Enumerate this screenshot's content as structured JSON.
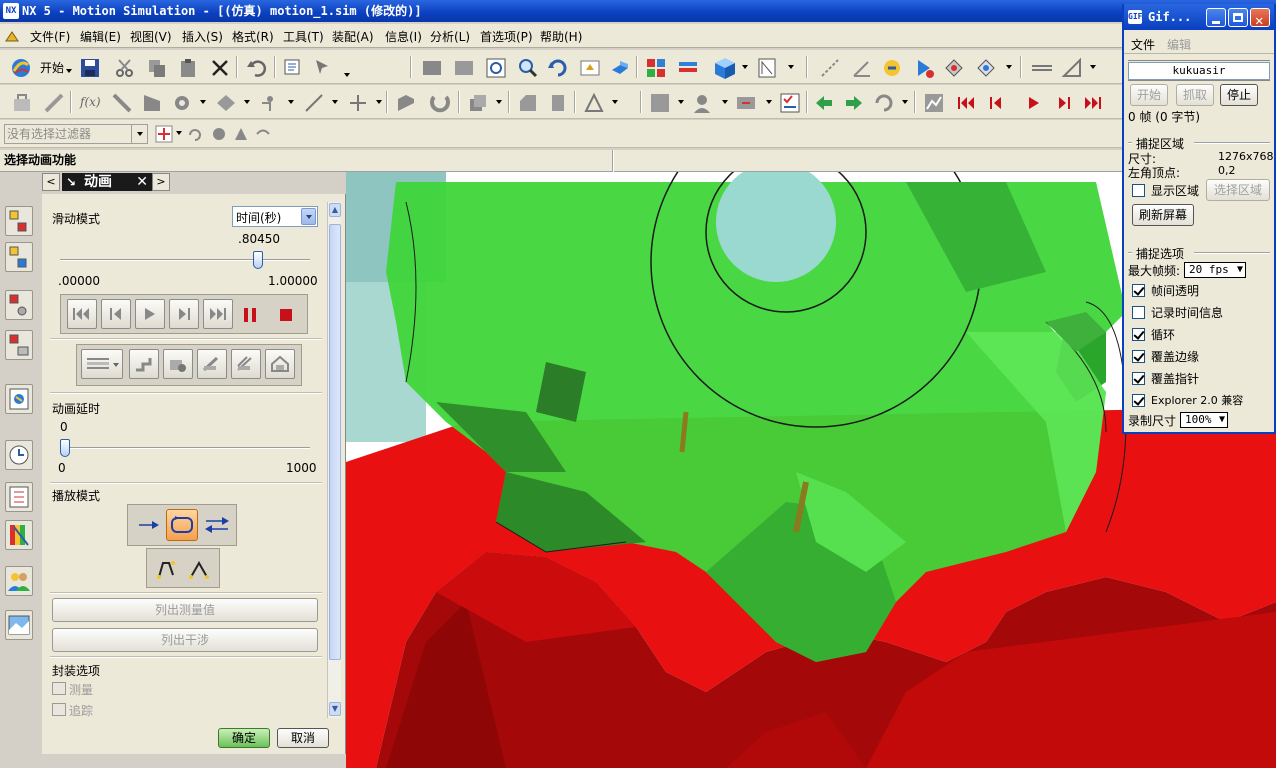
{
  "window": {
    "title": "NX 5 - Motion Simulation - [(仿真) motion_1.sim (修改的)]",
    "app_icon": "nx-logo-icon"
  },
  "menu": [
    "文件(F)",
    "编辑(E)",
    "视图(V)",
    "插入(S)",
    "格式(R)",
    "工具(T)",
    "装配(A)",
    "信息(I)",
    "分析(L)",
    "首选项(P)",
    "帮助(H)"
  ],
  "toolbar": {
    "start_label": "开始",
    "filter_placeholder": "没有选择过滤器"
  },
  "cue_line": "选择动画功能",
  "dialog": {
    "title": "动画",
    "slide_mode_label": "滑动模式",
    "slide_mode_value": "时间(秒)",
    "time_slider": {
      "value_label": ".80450",
      "min_label": ".00000",
      "max_label": "1.00000",
      "value": 0.8045,
      "min": 0,
      "max": 1
    },
    "delay_label": "动画延时",
    "delay_slider": {
      "value_label": "0",
      "min_label": "0",
      "max_label": "1000",
      "value": 0,
      "min": 0,
      "max": 1000
    },
    "play_mode_label": "播放模式",
    "list_measure": "列出测量值",
    "list_interference": "列出干涉",
    "package_label": "封装选项",
    "measure_label": "测量",
    "trace_label": "追踪",
    "ok": "确定",
    "cancel": "取消"
  },
  "gif": {
    "title": "Gif...",
    "menu_file": "文件",
    "menu_edit": "编辑",
    "name": "kukuasir",
    "start": "开始",
    "capture": "抓取",
    "stop": "停止",
    "frames": "0 帧 (0 字节)",
    "capture_area": "捕捉区域",
    "size_label": "尺寸:",
    "size_value": "1276x768",
    "corner_label": "左角顶点:",
    "corner_value": "0,2",
    "show_area": "显示区域",
    "select_area": "选择区域",
    "refresh": "刷新屏幕",
    "capture_options": "捕捉选项",
    "max_fps_label": "最大帧频:",
    "max_fps_value": "20 fps",
    "interframe_transparency": "帧间透明",
    "record_time": "记录时间信息",
    "loop": "循环",
    "cover_edge": "覆盖边缘",
    "cover_pointer": "覆盖指针",
    "explorer_compat": "Explorer 2.0 兼容",
    "record_size_label": "录制尺寸",
    "record_size_value": "100%",
    "checks": {
      "interframe_transparency": true,
      "record_time": false,
      "loop": true,
      "cover_edge": true,
      "cover_pointer": true,
      "explorer_compat": true,
      "show_area": false
    }
  },
  "colors": {
    "gear_green": "#3fd63a",
    "rack_red": "#e81010",
    "title_blue": "#0a3fbf"
  }
}
